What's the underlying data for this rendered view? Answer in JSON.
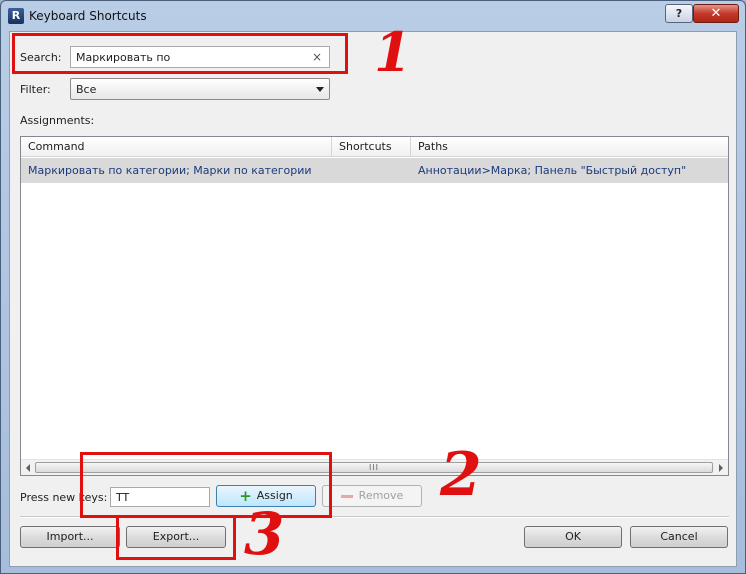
{
  "window": {
    "title": "Keyboard Shortcuts",
    "help_label": "?",
    "close_label": "✕"
  },
  "search": {
    "label": "Search:",
    "value": "Маркировать по",
    "clear_icon": "×"
  },
  "filter": {
    "label": "Filter:",
    "value": "Все"
  },
  "assignments": {
    "label": "Assignments:",
    "columns": [
      "Command",
      "Shortcuts",
      "Paths"
    ],
    "rows": [
      {
        "command": "Маркировать по категории; Марки по категории",
        "shortcuts": "",
        "paths": "Аннотации>Марка; Панель \"Быстрый доступ\""
      }
    ]
  },
  "scrollbar": {
    "grip": "III"
  },
  "keys": {
    "label": "Press new keys:",
    "value": "TT",
    "assign_label": "Assign",
    "remove_label": "Remove"
  },
  "footer": {
    "import_label": "Import...",
    "export_label": "Export...",
    "ok_label": "OK",
    "cancel_label": "Cancel"
  },
  "annotations": {
    "one": "1",
    "two": "2",
    "three": "3",
    "color": "#e01010"
  }
}
